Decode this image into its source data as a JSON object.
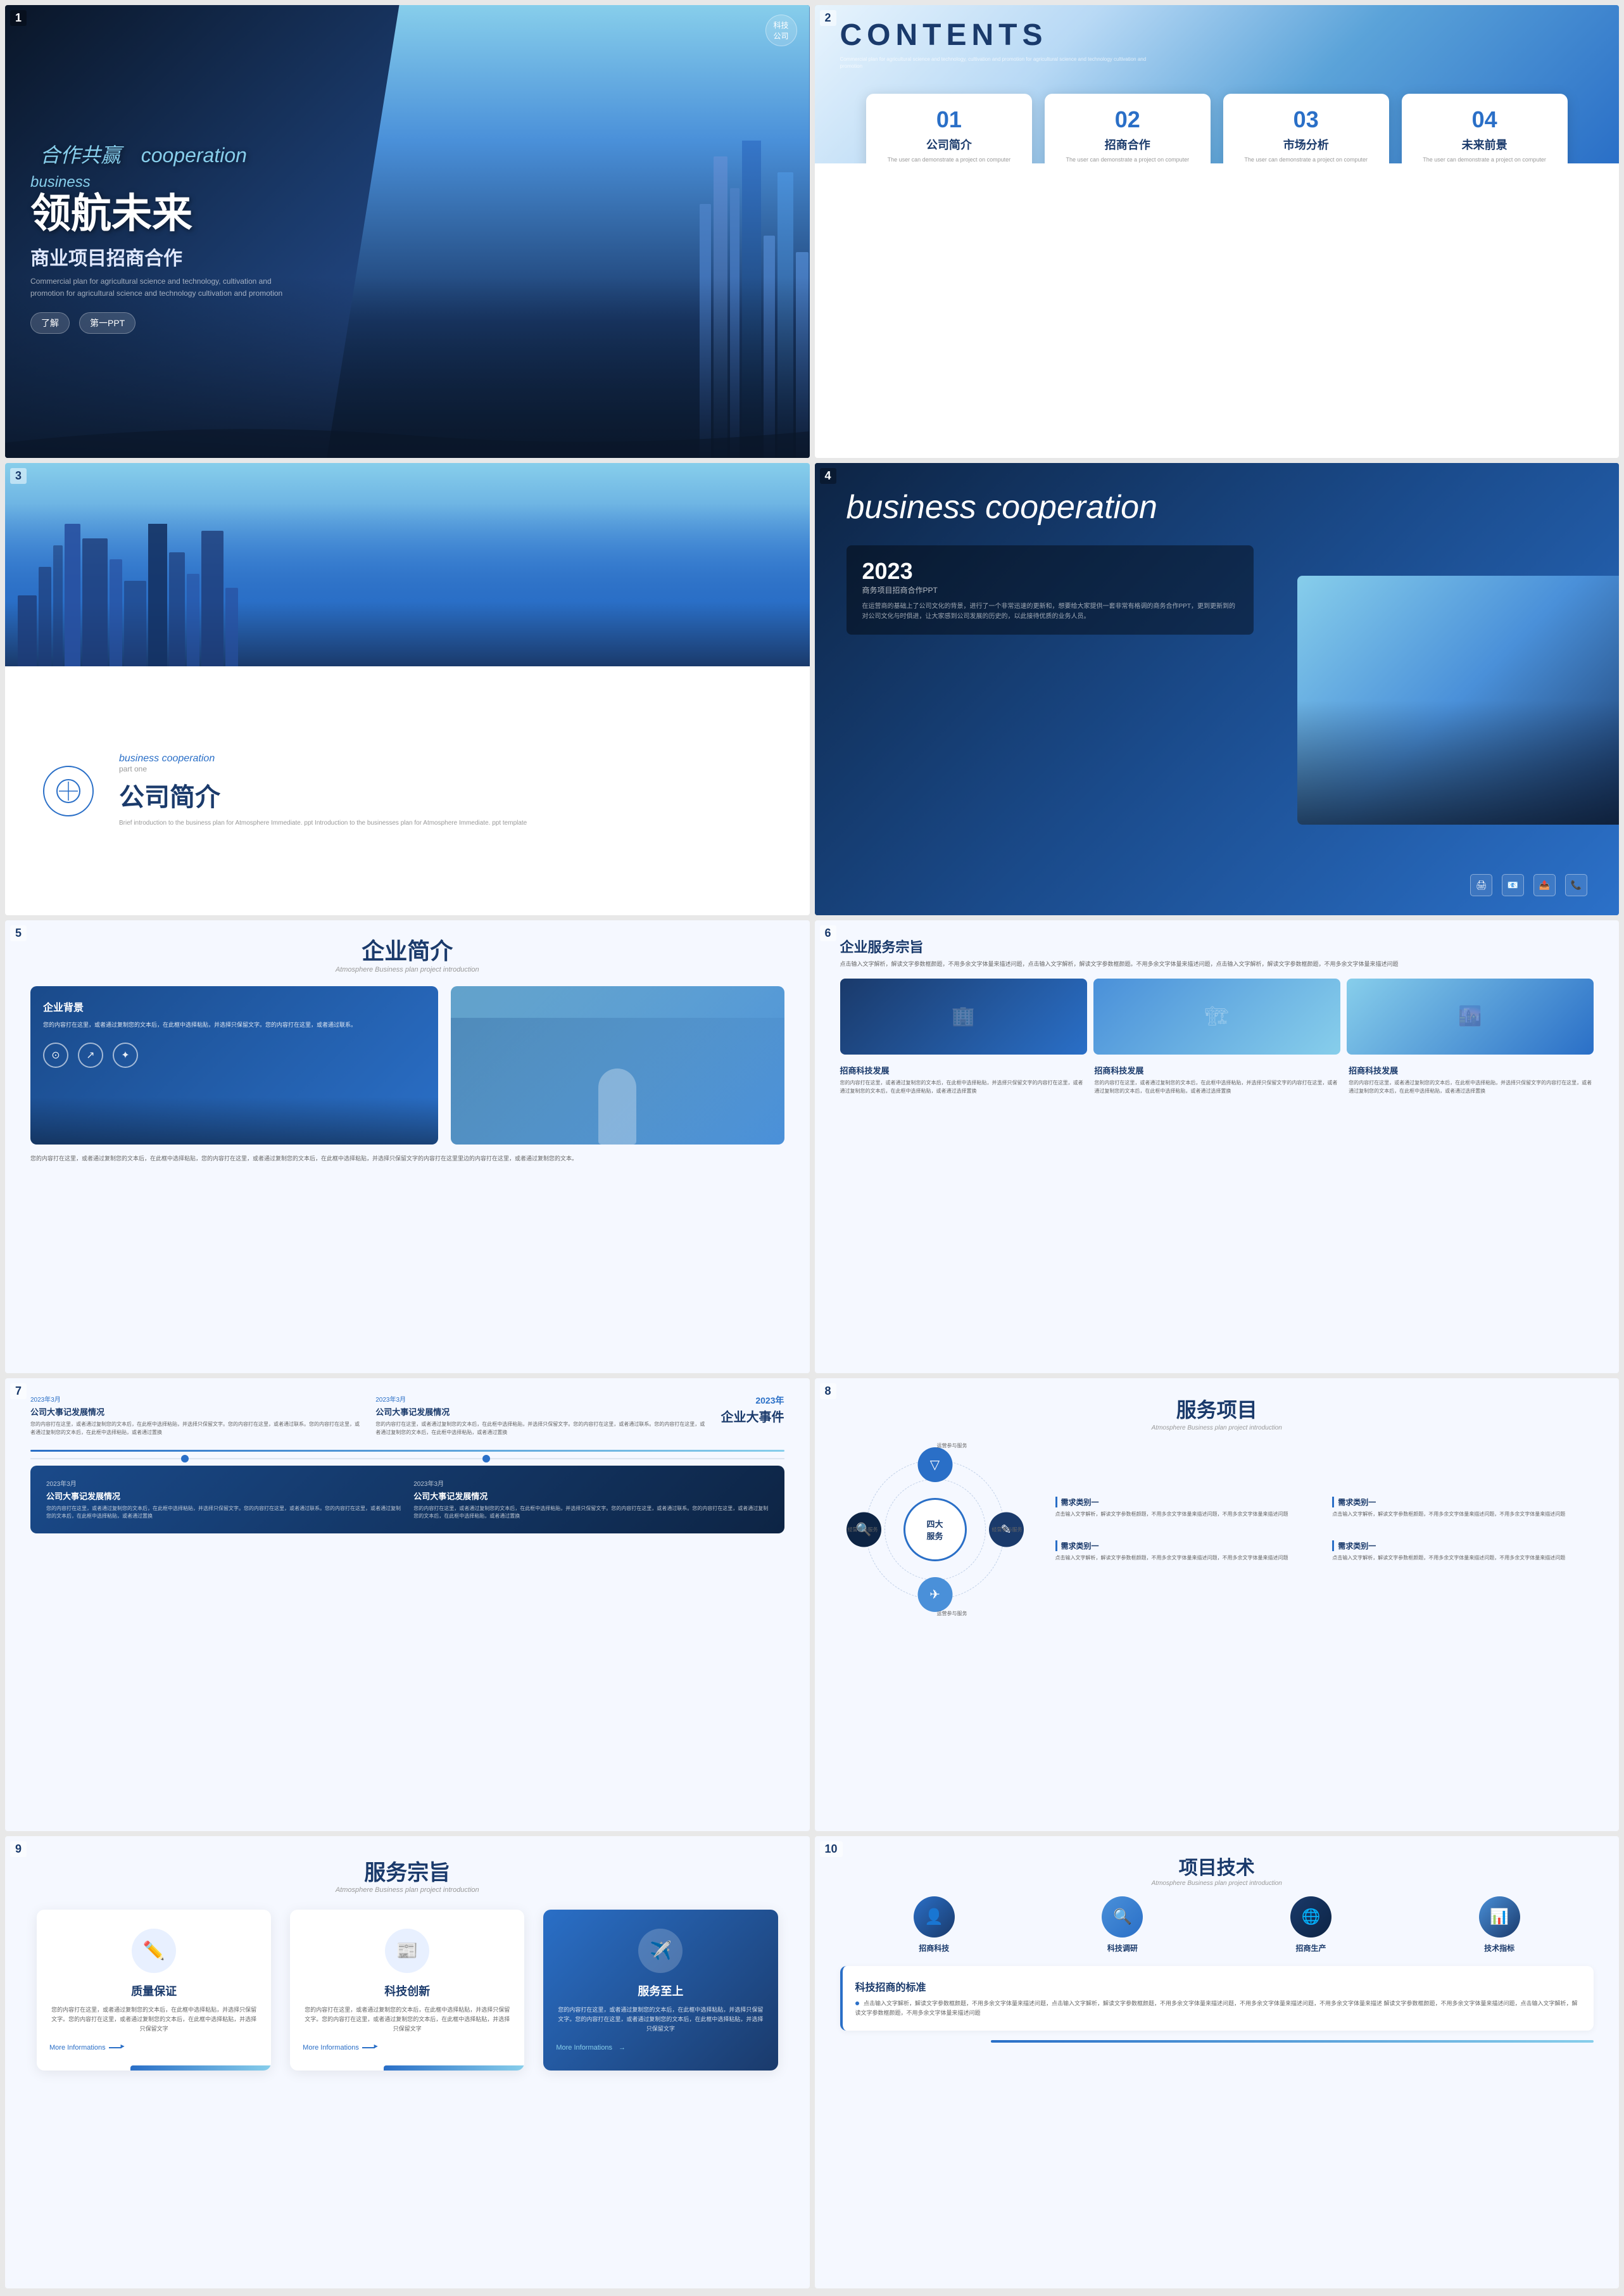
{
  "slides": [
    {
      "number": "1",
      "title1": "合作共赢",
      "title1_en": "cooperation",
      "title2": "领航未来",
      "business": "business",
      "subtitle": "商业项目招商合作",
      "desc": "Commercial plan for agricultural science and technology, cultivation and promotion for agricultural science and technology cultivation and promotion",
      "badge1": "了解",
      "badge2": "第一PPT",
      "logo": "科技公司"
    },
    {
      "number": "2",
      "title": "CONTENTS",
      "subtitle": "Commercial plan for agricultural science and technology, cultivation and promotion for agricultural science and technology cultivation and promotion",
      "cards": [
        {
          "num": "01",
          "title": "公司简介",
          "desc": "The user can demonstrate a project on computer"
        },
        {
          "num": "02",
          "title": "招商合作",
          "desc": "The user can demonstrate a project on computer"
        },
        {
          "num": "03",
          "title": "市场分析",
          "desc": "The user can demonstrate a project on computer"
        },
        {
          "num": "04",
          "title": "未来前景",
          "desc": "The user can demonstrate a project on computer"
        }
      ]
    },
    {
      "number": "3",
      "en_title": "business cooperation",
      "part": "part one",
      "main_title": "公司简介",
      "desc": "Brief introduction to the business plan for Atmosphere Immediate. ppt Introduction to the businesses plan for Atmosphere Immediate. ppt template"
    },
    {
      "number": "4",
      "title": "business cooperation",
      "year": "2023",
      "card_sub": "商务项目招商合作PPT",
      "card_desc": "在运营商的基础上了公司文化的背景，进行了一个非常迅速的更新和，想要给大家提供一套非常有格调的商务合作PPT，更到更新到的对公司文化与时俱进，让大家感到公司发展的历史的，以此接待优质的业务人员。",
      "icons": [
        "🖨",
        "📧",
        "📤",
        "📞"
      ]
    },
    {
      "number": "5",
      "title": "企业简介",
      "en": "Atmosphere Business plan project introduction",
      "bg_label": "企业背景",
      "bg_desc": "您的内容打在这里，或者通过复制您的文本后，在此框中选择粘贴，并选择只保留文字。您的内容打在这里，或者通过联系。",
      "bottom_text": "您的内容打在这里，或者通过复制您的文本后，在此框中选择粘贴，您的内容打在这里，或者通过复制您的文本后，在此框中选择粘贴，并选择只保留文字的内容打在这里里边的内容打在这里，或者通过复制您的文本。",
      "icons": [
        "⊙",
        "↗",
        "✦"
      ]
    },
    {
      "number": "6",
      "title": "企业服务宗旨",
      "desc": "点击输入文字解析，解读文字参数框颜题，不用多余文字体量来描述问题，点击输入文字解析，解读文字参数框颜题。不用多余文字体量来描述问题，点击输入文字解析，解读文字参数框颜题，不用多余文字体量来描述问题",
      "cards": [
        {
          "title": "招商科技发展",
          "desc": "您的内容打在这里，或者通过复制您的文本后，在此框中选择粘贴，并选择只保留文字的内容打在这里，或者通过复制您的文本后，在此框中选择粘贴，或者通过选择置换"
        },
        {
          "title": "招商科技发展",
          "desc": "您的内容打在这里，或者通过复制您的文本后，在此框中选择粘贴，并选择只保留文字的内容打在这里，或者通过复制您的文本后，在此框中选择粘贴，或者通过选择置换"
        },
        {
          "title": "招商科技发展",
          "desc": "您的内容打在这里，或者通过复制您的文本后，在此框中选择粘贴，并选择只保留文字的内容打在这里，或者通过复制您的文本后，在此框中选择粘贴，或者通过选择置换"
        }
      ]
    },
    {
      "number": "7",
      "year_title": "2023年",
      "year_sub": "企业大事件",
      "items_top": [
        {
          "header": "2023年3月",
          "title": "公司大事记发展情况",
          "desc": "您的内容打在这里，或者通过复制您的文本后，在此框中选择粘贴，并选择只保留文字。您的内容打在这里，或者通过联系。您的内容打在这里，或者通过复制您的文本后，在此框中选择粘贴，或者通过置换"
        },
        {
          "header": "2023年3月",
          "title": "公司大事记发展情况",
          "desc": "您的内容打在这里，或者通过复制您的文本后，在此框中选择粘贴，并选择只保留文字。您的内容打在这里，或者通过联系。您的内容打在这里，或者通过复制您的文本后，在此框中选择粘贴，或者通过置换"
        }
      ],
      "items_bottom": [
        {
          "header": "2023年3月",
          "title": "公司大事记发展情况",
          "desc": "您的内容打在这里，或者通过复制您的文本后，在此框中选择粘贴，并选择只保留文字。您的内容打在这里，或者通过联系。您的内容打在这里，或者通过复制您的文本后，在此框中选择粘贴，或者通过置换"
        },
        {
          "header": "2023年3月",
          "title": "公司大事记发展情况",
          "desc": "您的内容打在这里，或者通过复制您的文本后，在此框中选择粘贴，并选择只保留文字。您的内容打在这里，或者通过联系。您的内容打在这里，或者通过复制您的文本后，在此框中选择粘贴，或者通过置换"
        }
      ]
    },
    {
      "number": "8",
      "title": "服务项目",
      "en": "Atmosphere Business plan project introduction",
      "center_label": "四大\n服务",
      "orbit_labels": [
        "▽",
        "✎",
        "🔍",
        "✈"
      ],
      "orbit_subs": [
        "运营参与服务",
        "经营参与服务",
        "经营参与服务",
        "运营参与服务"
      ],
      "requirements": [
        {
          "title": "需求类别一",
          "desc": "点击输入文字解析，解读文字参数框颜题，不用多余文字体量来描述问题，不用多余文字体量来描述问题"
        },
        {
          "title": "需求类别一",
          "desc": "点击输入文字解析，解读文字参数框颜题，不用多余文字体量来描述问题，不用多余文字体量来描述问题"
        },
        {
          "title": "需求类别一",
          "desc": "点击输入文字解析，解读文字参数框颜题，不用多余文字体量来描述问题，不用多余文字体量来描述问题"
        },
        {
          "title": "需求类别一",
          "desc": "点击输入文字解析，解读文字参数框颜题，不用多余文字体量来描述问题，不用多余文字体量来描述问题"
        }
      ]
    },
    {
      "number": "9",
      "title": "服务宗旨",
      "en": "Atmosphere Business plan project introduction",
      "cards": [
        {
          "icon": "✏️",
          "title": "质量保证",
          "desc": "您的内容打在这里，或者通过复制您的文本后，在此框中选择粘贴，并选择只保留文字。您的内容打在这里，或者通过复制您的文本后，在此框中选择粘贴，并选择只保留文字",
          "more": "More Informations"
        },
        {
          "icon": "📰",
          "title": "科技创新",
          "desc": "您的内容打在这里，或者通过复制您的文本后，在此框中选择粘贴，并选择只保留文字。您的内容打在这里，或者通过复制您的文本后，在此框中选择粘贴，并选择只保留文字",
          "more": "More Informations"
        },
        {
          "icon": "✈️",
          "title": "服务至上",
          "desc": "您的内容打在这里，或者通过复制您的文本后，在此框中选择粘贴，并选择只保留文字。您的内容打在这里，或者通过复制您的文本后，在此框中选择粘贴，并选择只保留文字",
          "more": "More Informations"
        }
      ]
    },
    {
      "number": "10",
      "title": "项目技术",
      "en": "Atmosphere Business plan project introduction",
      "icons": [
        {
          "icon": "👤",
          "label": "招商科技"
        },
        {
          "icon": "🔍",
          "label": "科技调研"
        },
        {
          "icon": "🌐",
          "label": "招商生产"
        },
        {
          "icon": "📊",
          "label": "技术指标"
        }
      ],
      "standard_title": "科技招商的标准",
      "standard_desc": "点击输入文字解析，解读文字参数框颜题，不用多余文字体量来描述问题，点击输入文字解析，解读文字参数框颜题，不用多余文字体量来描述问题，不用多余文字体量来描述问题，不用多余文字体量来描述 解读文字参数框颜题，不用多余文字体量来描述问题，点击输入文字解析，解读文字参数框颜题，不用多余文字体量来描述问题"
    }
  ]
}
